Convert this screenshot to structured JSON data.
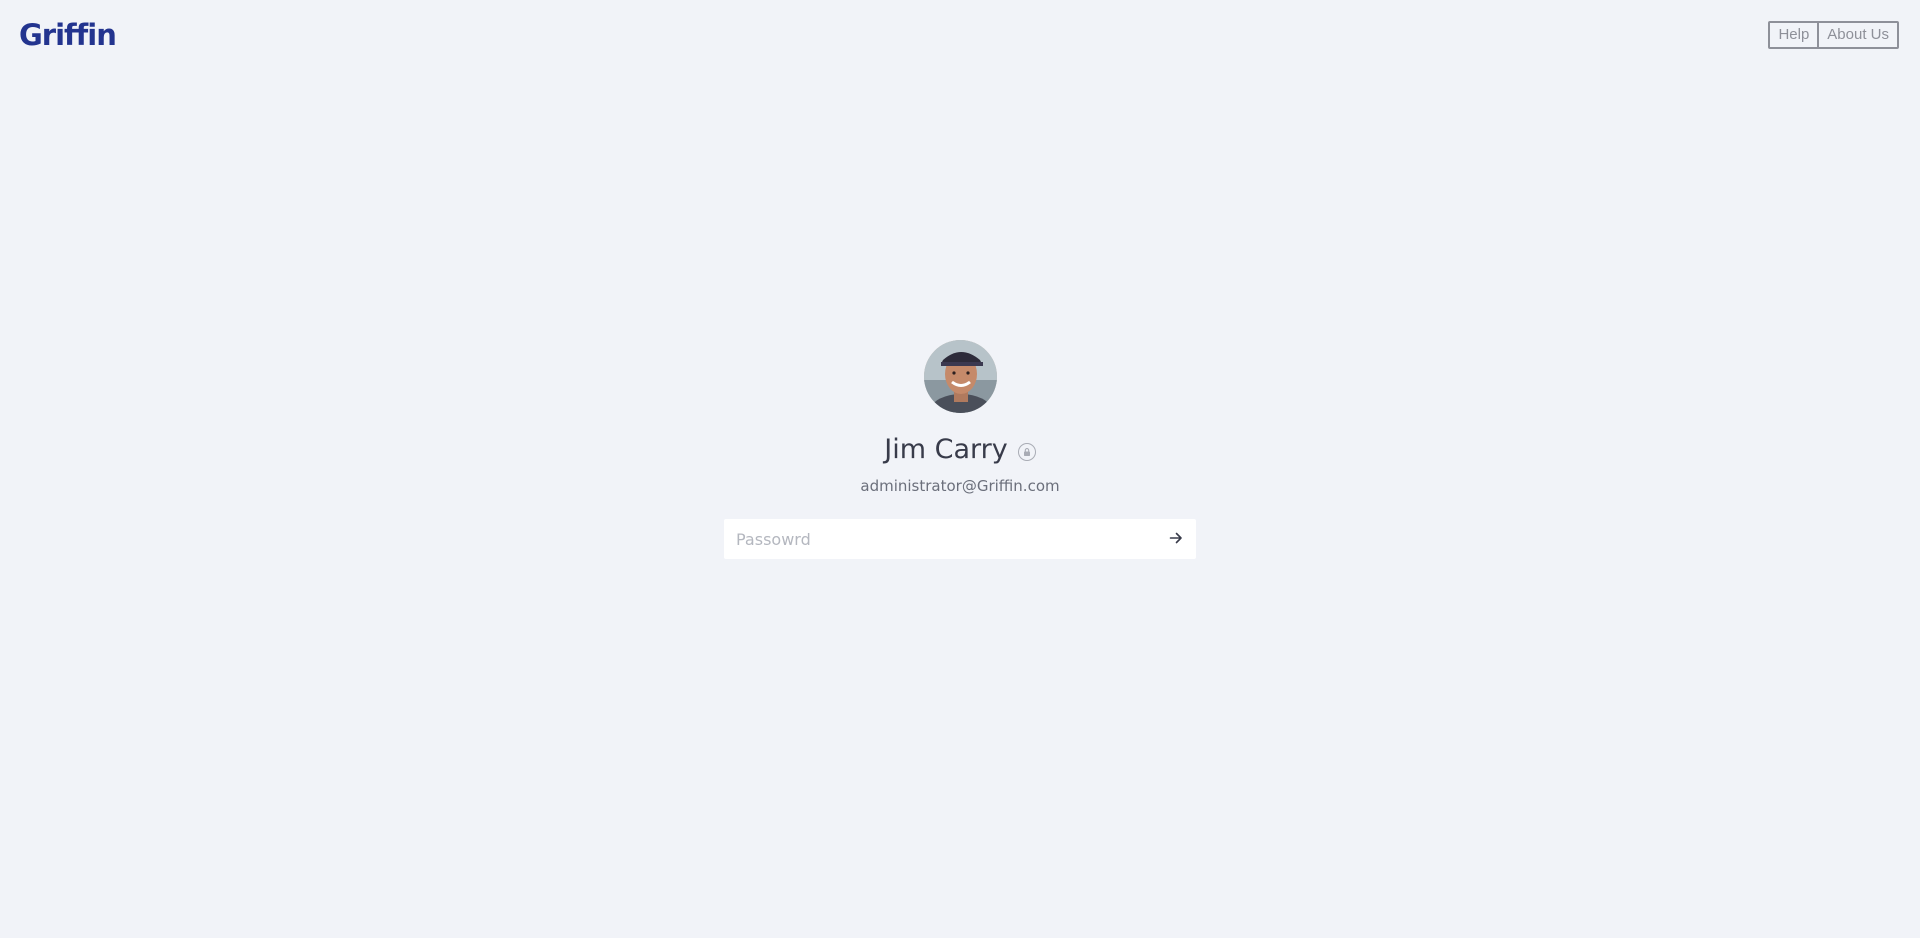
{
  "header": {
    "logo_text": "Griffin",
    "nav": {
      "help_label": "Help",
      "about_label": "About Us"
    }
  },
  "lock_screen": {
    "user_name": "Jim Carry",
    "user_email": "administrator@Griffin.com",
    "password_placeholder": "Passowrd",
    "password_value": "",
    "submit_icon": "arrow-right-icon",
    "status_icon": "lock-icon"
  },
  "colors": {
    "background": "#f1f3f8",
    "brand": "#23348f",
    "text_primary": "#383b4a",
    "text_secondary": "#6b6f7b",
    "nav_border": "#8e9099"
  }
}
